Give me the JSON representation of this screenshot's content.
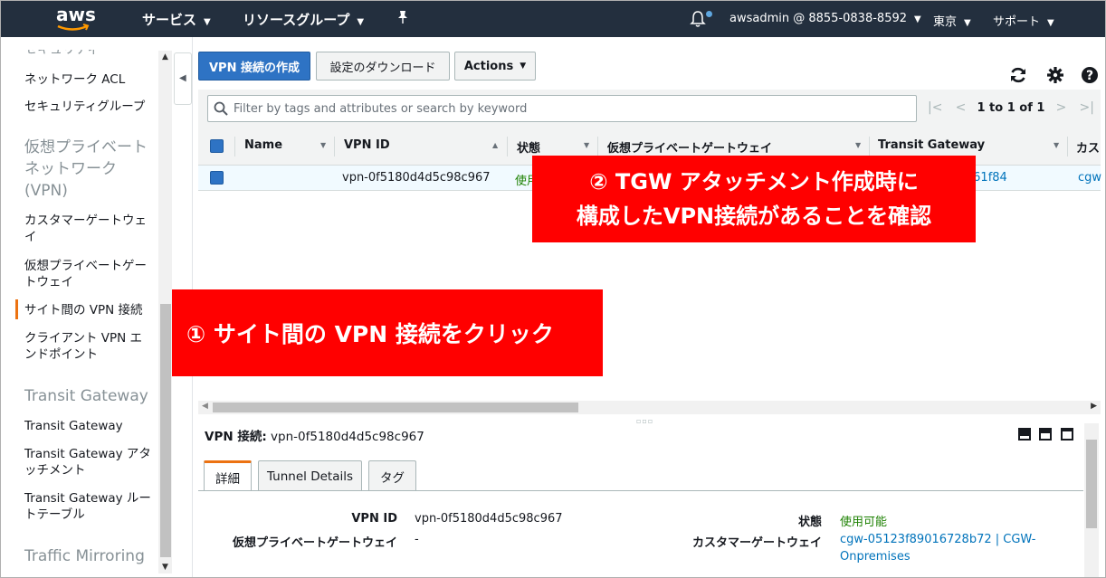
{
  "topnav": {
    "logo": "aws",
    "services": "サービス",
    "resource_groups": "リソースグループ",
    "account": "awsadmin @ 8855-0838-8592",
    "region": "東京",
    "support": "サポート",
    "icons": [
      "pin-icon",
      "bell-icon"
    ]
  },
  "sidebar": {
    "items": [
      {
        "label": "セキュリティ",
        "type": "head"
      },
      {
        "label": "ネットワーク ACL"
      },
      {
        "label": "セキュリティグループ"
      },
      {
        "label": "仮想プライベートネットワーク (VPN)",
        "type": "head"
      },
      {
        "label": "カスタマーゲートウェイ"
      },
      {
        "label": "仮想プライベートゲートウェイ"
      },
      {
        "label": "サイト間の VPN 接続",
        "active": true
      },
      {
        "label": "クライアント VPN エンドポイント"
      },
      {
        "label": "Transit Gateway",
        "type": "head"
      },
      {
        "label": "Transit Gateway"
      },
      {
        "label": "Transit Gateway アタッチメント"
      },
      {
        "label": "Transit Gateway ルートテーブル"
      },
      {
        "label": "Traffic Mirroring",
        "type": "head"
      }
    ]
  },
  "toolbar": {
    "create_label": "VPN 接続の作成",
    "download_label": "設定のダウンロード",
    "actions_label": "Actions",
    "icons": [
      "refresh-icon",
      "gear-icon",
      "help-icon"
    ]
  },
  "filter": {
    "placeholder": "Filter by tags and attributes or search by keyword",
    "pagination": "1 to 1 of 1"
  },
  "table": {
    "columns": [
      "Name",
      "VPN ID",
      "状態",
      "仮想プライベートゲートウェイ",
      "Transit Gateway",
      "カス"
    ],
    "rows": [
      {
        "name": "",
        "vpn_id": "vpn-0f5180d4d5c98c967",
        "status": "使用",
        "vgw": "",
        "tgw": "c61f84",
        "cgw": "cgw"
      }
    ]
  },
  "details": {
    "title_prefix": "VPN 接続:",
    "title_value": "vpn-0f5180d4d5c98c967",
    "tabs": [
      "詳細",
      "Tunnel Details",
      "タグ"
    ],
    "fields": {
      "vpn_id_label": "VPN ID",
      "vpn_id_value": "vpn-0f5180d4d5c98c967",
      "vgw_label": "仮想プライベートゲートウェイ",
      "vgw_value": "-",
      "status_label": "状態",
      "status_value": "使用可能",
      "cgw_label": "カスタマーゲートウェイ",
      "cgw_value_line1": "cgw-05123f89016728b72 | CGW-",
      "cgw_value_line2": "Onpremises"
    }
  },
  "annotations": {
    "step1": "① サイト間の VPN 接続をクリック",
    "step2_line1": "② TGW アタッチメント作成時に",
    "step2_line2": "構成したVPN接続があることを確認"
  },
  "colors": {
    "nav_bg": "#232f3e",
    "primary": "#2e73c4",
    "active_accent": "#ec7211",
    "status_green": "#1d8102",
    "link": "#0073bb",
    "callout": "#ff0000"
  }
}
